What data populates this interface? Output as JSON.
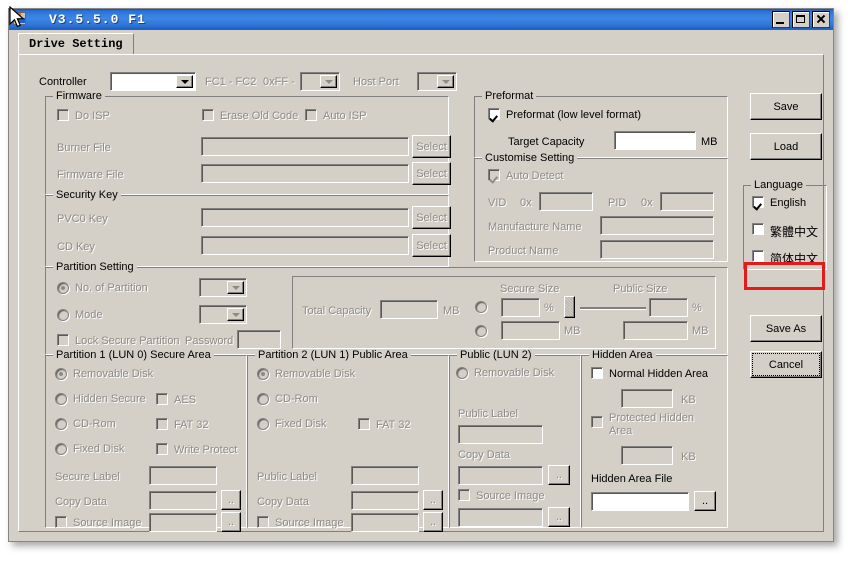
{
  "window": {
    "title": "V3.5.5.0 F1",
    "icon": "app-icon",
    "buttons": {
      "minimize": "minimize",
      "maximize": "maximize",
      "close": "close"
    }
  },
  "tab": {
    "label": "Drive Setting"
  },
  "top_row": {
    "controller_label": "Controller",
    "controller_value": "",
    "fc_label": "FC1 - FC2",
    "hex_label": "0xFF -",
    "hex_value": "",
    "host_port_label": "Host Port",
    "host_port_value": ""
  },
  "firmware": {
    "title": "Firmware",
    "do_isp": "Do ISP",
    "erase_old_code": "Erase Old Code",
    "auto_isp": "Auto ISP",
    "burner_file_label": "Burner File",
    "burner_file_value": "",
    "burner_select": "Select",
    "firmware_file_label": "Firmware File",
    "firmware_file_value": "",
    "firmware_select": "Select"
  },
  "security_key": {
    "title": "Security Key",
    "pvc0_label": "PVC0 Key",
    "pvc0_value": "",
    "pvc0_select": "Select",
    "cd_label": "CD Key",
    "cd_value": "",
    "cd_select": "Select"
  },
  "preformat": {
    "title": "Preformat",
    "checkbox_label": "Preformat (low level format)",
    "checked": true,
    "target_capacity_label": "Target Capacity",
    "target_capacity_value": "",
    "unit": "MB"
  },
  "customise": {
    "title": "Customise Setting",
    "auto_detect": "Auto Detect",
    "auto_detect_checked": true,
    "vid_label": "VID",
    "vid_prefix": "0x",
    "vid_value": "",
    "pid_label": "PID",
    "pid_prefix": "0x",
    "pid_value": "",
    "manufacture_label": "Manufacture Name",
    "manufacture_value": "",
    "product_label": "Product Name",
    "product_value": ""
  },
  "partition_setting": {
    "title": "Partition Setting",
    "no_of_partition": "No. of Partition",
    "no_of_partition_value": "",
    "mode": "Mode",
    "mode_value": "",
    "lock_secure_partition": "Lock Secure Partition",
    "password_label": "Password",
    "password_value": "",
    "total_capacity_label": "Total Capacity",
    "total_capacity_value": "",
    "total_capacity_unit": "MB",
    "secure_size_label": "Secure Size",
    "public_size_label": "Public Size",
    "secure_percent_value": "",
    "secure_percent_unit": "%",
    "public_percent_value": "",
    "public_percent_unit": "%",
    "secure_mb_value": "",
    "secure_mb_unit": "MB",
    "public_mb_value": "",
    "public_mb_unit": "MB"
  },
  "partition1": {
    "title": "Partition 1 (LUN 0) Secure Area",
    "removable_disk": "Removable Disk",
    "hidden_secure": "Hidden Secure",
    "cd_rom": "CD-Rom",
    "fixed_disk": "Fixed Disk",
    "aes": "AES",
    "fat32": "FAT 32",
    "write_protect": "Write Protect",
    "secure_label_label": "Secure Label",
    "secure_label_value": "",
    "copy_data_label": "Copy Data",
    "copy_data_value": "",
    "copy_data_browse": "..",
    "source_image_label": "Source Image",
    "source_image_value": "",
    "source_image_browse": ".."
  },
  "partition2": {
    "title": "Partition 2 (LUN 1) Public Area",
    "removable_disk": "Removable Disk",
    "cd_rom": "CD-Rom",
    "fixed_disk": "Fixed Disk",
    "fat32": "FAT 32",
    "public_label_label": "Public Label",
    "public_label_value": "",
    "copy_data_label": "Copy Data",
    "copy_data_value": "",
    "copy_data_browse": "..",
    "source_image_label": "Source Image",
    "source_image_value": "",
    "source_image_browse": ".."
  },
  "public_lun2": {
    "title": "Public (LUN 2)",
    "removable_disk": "Removable Disk",
    "public_label_label": "Public Label",
    "public_label_value": "",
    "copy_data_label": "Copy Data",
    "copy_data_value": "",
    "copy_data_browse": "..",
    "source_image_label": "Source Image",
    "source_image_value": "",
    "source_image_browse": ".."
  },
  "hidden_area": {
    "title": "Hidden Area",
    "normal_hidden_area": "Normal Hidden Area",
    "normal_value": "",
    "normal_unit": "KB",
    "protected_hidden_area": "Protected Hidden Area",
    "protected_value": "",
    "protected_unit": "KB",
    "hidden_area_file_label": "Hidden Area File",
    "hidden_area_file_value": "",
    "hidden_area_file_browse": ".."
  },
  "sidebar": {
    "save": "Save",
    "load": "Load",
    "language_title": "Language",
    "lang_english": "English",
    "lang_traditional": "繁體中文",
    "lang_simplified": "简体中文",
    "save_as": "Save As",
    "cancel": "Cancel"
  },
  "annotation": {
    "highlight_color": "#e21b1b",
    "target": "lang_simplified"
  }
}
